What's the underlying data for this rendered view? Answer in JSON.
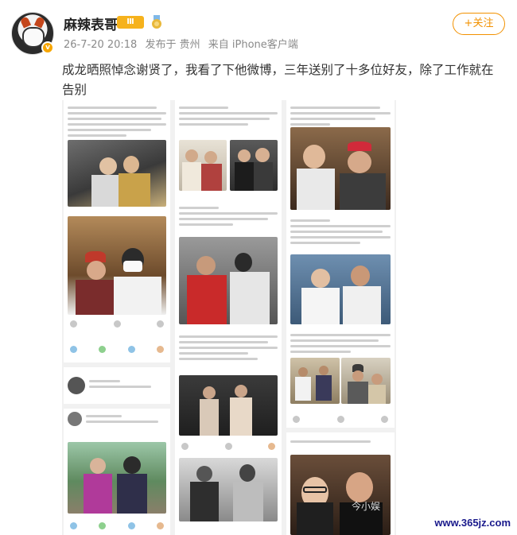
{
  "header": {
    "username": "麻辣表哥",
    "level_badge": "Ⅲ",
    "follow_label": "+关注",
    "meta": {
      "date": "26-7-20 20:18",
      "location": "发布于 贵州",
      "source": "来自 iPhone客户端"
    }
  },
  "post": {
    "text": "成龙晒照悼念谢贤了，我看了下他微博，三年送别了十多位好友，除了工作就在告别"
  },
  "watermark": {
    "site": "www.365jz.com",
    "tag": "今小娱"
  },
  "colors": {
    "accent": "#f29100",
    "crown": "#f6b21c",
    "vip": "#f7a600",
    "watermark": "#1a1a8c"
  },
  "icons": [
    "follow-plus-icon",
    "level-crown-icon",
    "medal-icon",
    "verified-v-icon",
    "repost-icon",
    "comment-icon",
    "like-icon"
  ]
}
